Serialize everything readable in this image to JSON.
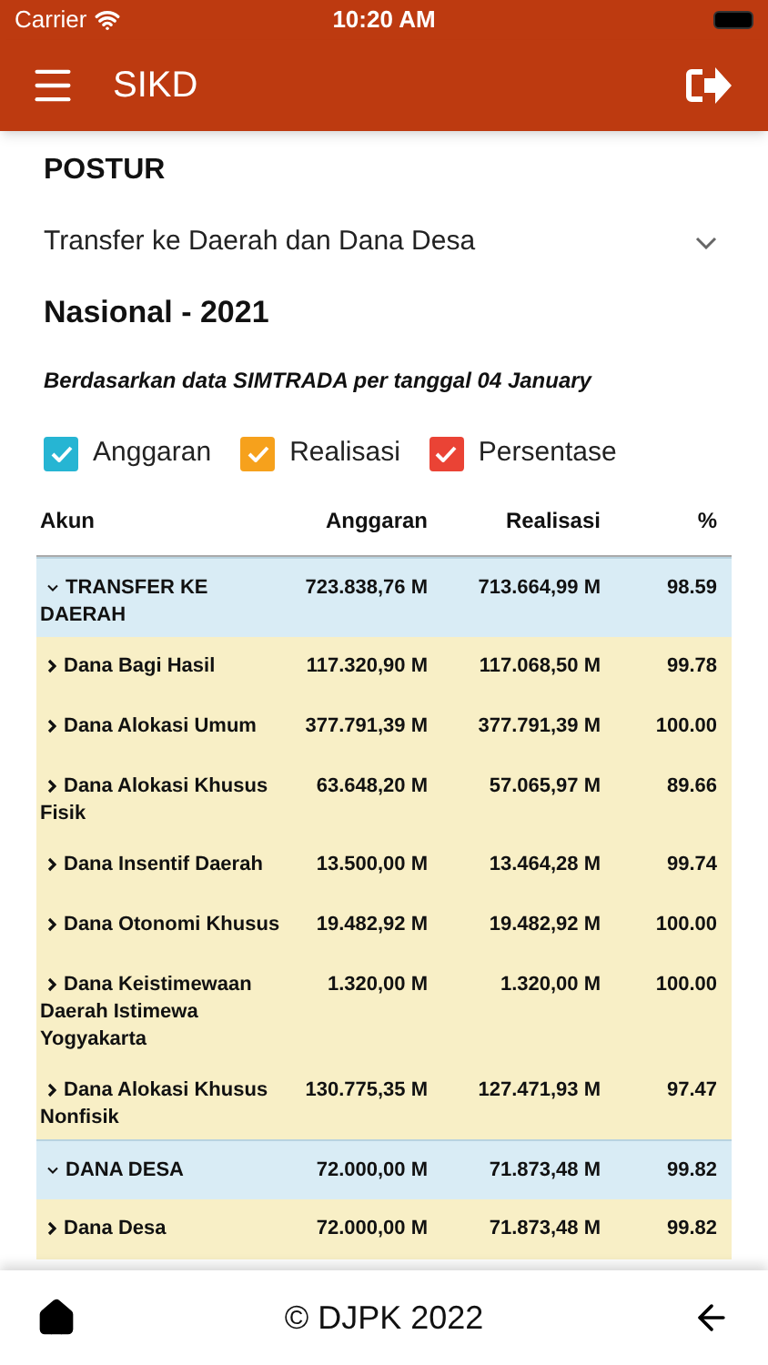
{
  "status_bar": {
    "carrier": "Carrier",
    "time": "10:20 AM"
  },
  "header": {
    "title": "SIKD"
  },
  "section_title": "POSTUR",
  "dropdown": {
    "value": "Transfer ke Daerah dan Dana Desa"
  },
  "subtitle": "Nasional - 2021",
  "note": "Berdasarkan data SIMTRADA per tanggal 04 January",
  "legend": [
    {
      "label": "Anggaran",
      "checked": true,
      "color": "#26b5d3"
    },
    {
      "label": "Realisasi",
      "checked": true,
      "color": "#f6a11c"
    },
    {
      "label": "Persentase",
      "checked": true,
      "color": "#ea4335"
    }
  ],
  "table": {
    "columns": [
      "Akun",
      "Anggaran",
      "Realisasi",
      "%"
    ],
    "rows": [
      {
        "kind": "group",
        "expanded": true,
        "akun": "TRANSFER KE DAERAH",
        "anggaran": "723.838,76 M",
        "realisasi": "713.664,99 M",
        "persen": "98.59"
      },
      {
        "kind": "item",
        "expanded": false,
        "akun": "Dana Bagi Hasil",
        "anggaran": "117.320,90 M",
        "realisasi": "117.068,50 M",
        "persen": "99.78"
      },
      {
        "kind": "item",
        "expanded": false,
        "akun": "Dana Alokasi Umum",
        "anggaran": "377.791,39 M",
        "realisasi": "377.791,39 M",
        "persen": "100.00"
      },
      {
        "kind": "item",
        "expanded": false,
        "akun": "Dana Alokasi Khusus Fisik",
        "anggaran": "63.648,20 M",
        "realisasi": "57.065,97 M",
        "persen": "89.66"
      },
      {
        "kind": "item",
        "expanded": false,
        "akun": "Dana Insentif Daerah",
        "anggaran": "13.500,00 M",
        "realisasi": "13.464,28 M",
        "persen": "99.74"
      },
      {
        "kind": "item",
        "expanded": false,
        "akun": "Dana Otonomi Khusus",
        "anggaran": "19.482,92 M",
        "realisasi": "19.482,92 M",
        "persen": "100.00"
      },
      {
        "kind": "item",
        "expanded": false,
        "akun": "Dana Keistimewaan Daerah Istimewa Yogyakarta",
        "anggaran": "1.320,00 M",
        "realisasi": "1.320,00 M",
        "persen": "100.00"
      },
      {
        "kind": "item",
        "expanded": false,
        "akun": "Dana Alokasi Khusus Nonfisik",
        "anggaran": "130.775,35 M",
        "realisasi": "127.471,93 M",
        "persen": "97.47"
      },
      {
        "kind": "group",
        "expanded": true,
        "akun": "DANA DESA",
        "anggaran": "72.000,00 M",
        "realisasi": "71.873,48 M",
        "persen": "99.82"
      },
      {
        "kind": "item",
        "expanded": false,
        "akun": "Dana Desa",
        "anggaran": "72.000,00 M",
        "realisasi": "71.873,48 M",
        "persen": "99.82"
      }
    ]
  },
  "footer": {
    "text": "© DJPK 2022"
  }
}
